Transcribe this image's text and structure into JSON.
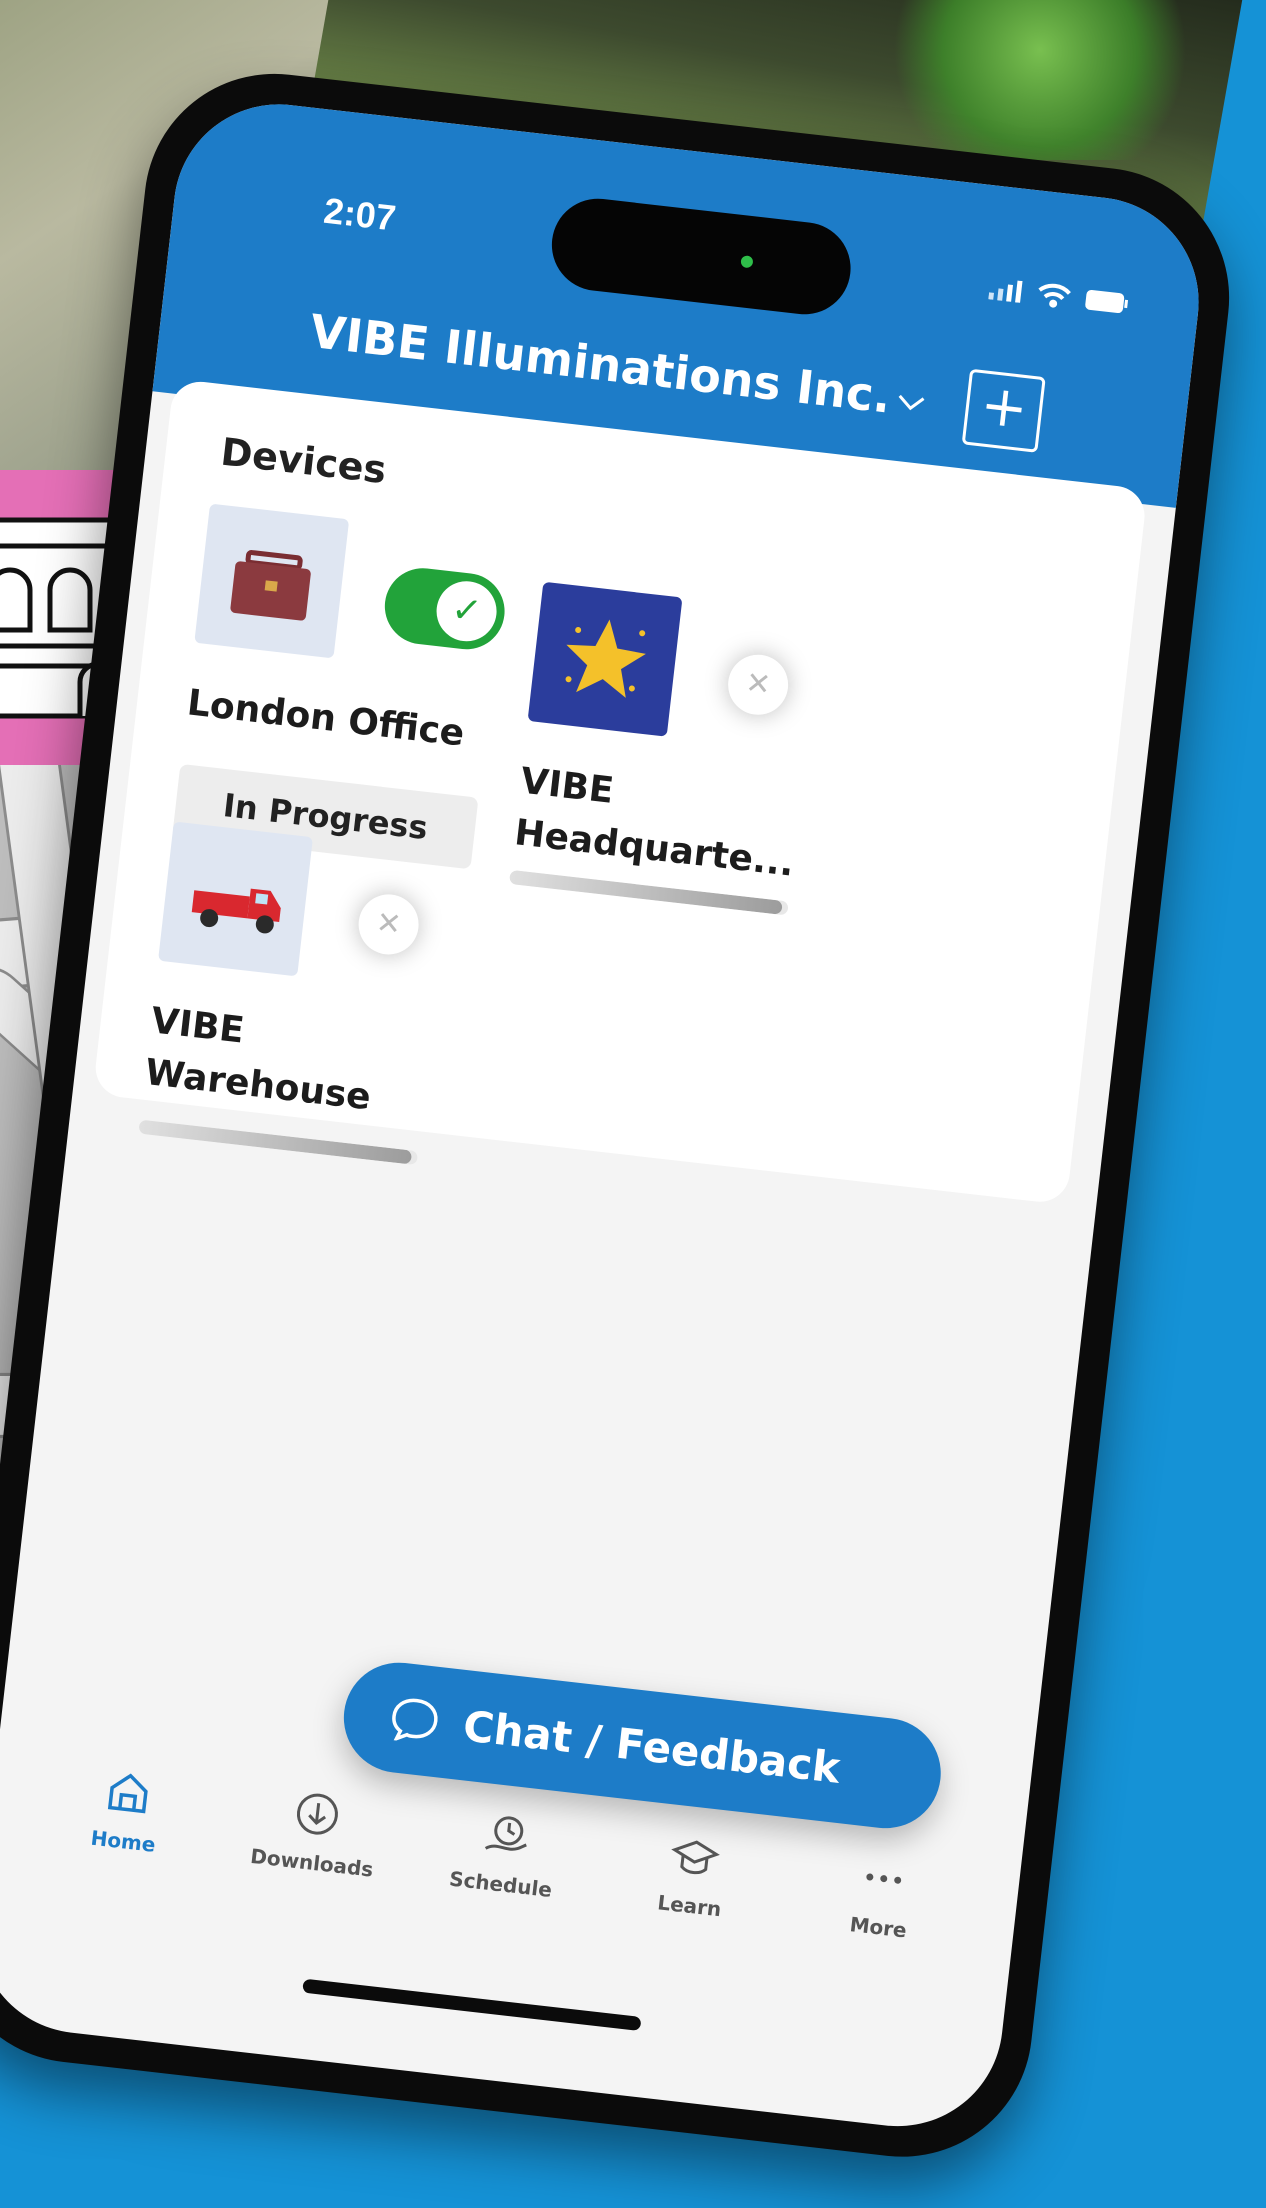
{
  "status_bar": {
    "time": "2:07"
  },
  "header": {
    "title": "VIBE Illuminations Inc.",
    "dropdown_icon": "chevron-down-icon",
    "add_button_label": "+"
  },
  "devices_section": {
    "title": "Devices",
    "devices": [
      {
        "name": "London Office",
        "icon": "briefcase-icon",
        "icon_bg": "#dfe6f2",
        "enabled": true,
        "status": "In Progress",
        "progress": 0
      },
      {
        "name": "VIBE Headquarte...",
        "icon": "star-icon",
        "icon_bg": "#2b3d9c",
        "enabled": false,
        "status": "",
        "progress": 0.98
      },
      {
        "name": "VIBE Warehouse",
        "icon": "truck-icon",
        "icon_bg": "#dfe6f2",
        "enabled": false,
        "status": "",
        "progress": 0.98
      }
    ]
  },
  "chat_button": {
    "label": "Chat / Feedback",
    "icon": "chat-bubble-icon"
  },
  "tabbar": {
    "tabs": [
      {
        "label": "Home",
        "icon": "home-icon",
        "active": true
      },
      {
        "label": "Downloads",
        "icon": "download-icon",
        "active": false
      },
      {
        "label": "Schedule",
        "icon": "schedule-icon",
        "active": false
      },
      {
        "label": "Learn",
        "icon": "graduation-cap-icon",
        "active": false
      },
      {
        "label": "More",
        "icon": "more-dots-icon",
        "active": false
      }
    ]
  },
  "colors": {
    "brand_blue": "#1d7cc8",
    "toggle_on": "#22a33a",
    "background": "#1592d6",
    "store_tile": "#e46fb6"
  }
}
